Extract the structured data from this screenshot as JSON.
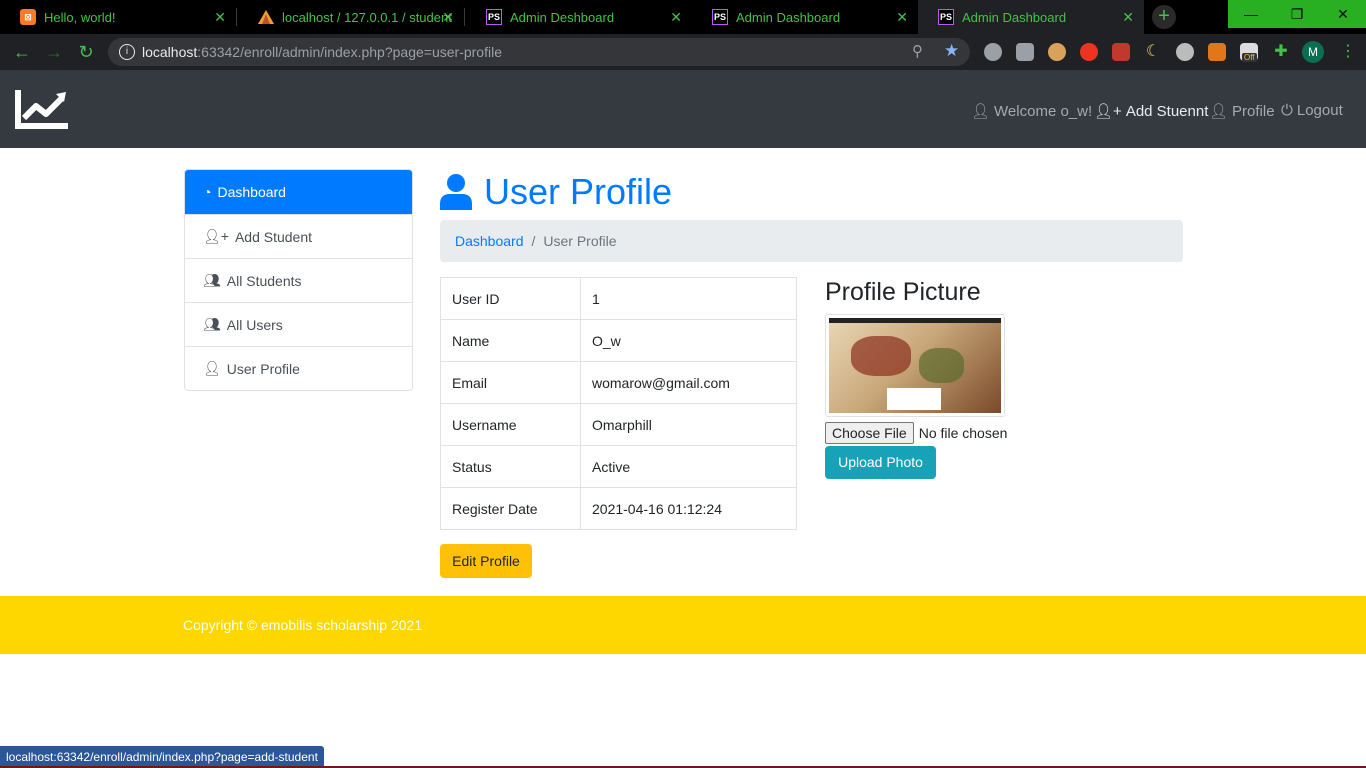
{
  "browser": {
    "tabs": [
      {
        "title": "Hello, world!",
        "favicon": "xampp-icon"
      },
      {
        "title": "localhost / 127.0.0.1 / student",
        "favicon": "phpmyadmin-icon"
      },
      {
        "title": "Admin Deshboard",
        "favicon": "phpstorm-icon"
      },
      {
        "title": "Admin Dashboard",
        "favicon": "phpstorm-icon"
      },
      {
        "title": "Admin Dashboard",
        "favicon": "phpstorm-icon"
      }
    ],
    "url_host": "localhost",
    "url_rest": ":63342/enroll/admin/index.php?page=user-profile",
    "profile_initial": "M",
    "ext_badge": "Off",
    "colors": {
      "chrome_accent": "#45c14a",
      "window_buttons": "#29b022"
    }
  },
  "navbar": {
    "welcome": "Welcome o_w!",
    "add_student": "Add Stuennt",
    "profile": "Profile",
    "logout": "Logout",
    "bg": "#343a40"
  },
  "sidebar": {
    "items": [
      {
        "label": "Dashboard",
        "icon": "tachometer-icon"
      },
      {
        "label": "Add Student",
        "icon": "user-plus-icon"
      },
      {
        "label": "All Students",
        "icon": "users-icon"
      },
      {
        "label": "All Users",
        "icon": "users-icon"
      },
      {
        "label": "User Profile",
        "icon": "user-icon"
      }
    ]
  },
  "main": {
    "title": "User Profile",
    "breadcrumb": {
      "link": "Dashboard",
      "separator": "/",
      "current": "User Profile"
    },
    "rows": [
      {
        "key": "User ID",
        "value": "1"
      },
      {
        "key": "Name",
        "value": "O_w"
      },
      {
        "key": "Email",
        "value": "womarow@gmail.com"
      },
      {
        "key": "Username",
        "value": "Omarphill"
      },
      {
        "key": "Status",
        "value": "Active"
      },
      {
        "key": "Register Date",
        "value": "2021-04-16 01:12:24"
      }
    ],
    "edit_button": "Edit Profile",
    "profile_picture_title": "Profile Picture",
    "choose_file": "Choose File",
    "no_file": "No file chosen",
    "upload_button": "Upload Photo"
  },
  "footer": {
    "text": "Copyright © emobilis scholarship 2021",
    "bg": "#ffd700"
  },
  "status_url": "localhost:63342/enroll/admin/index.php?page=add-student"
}
